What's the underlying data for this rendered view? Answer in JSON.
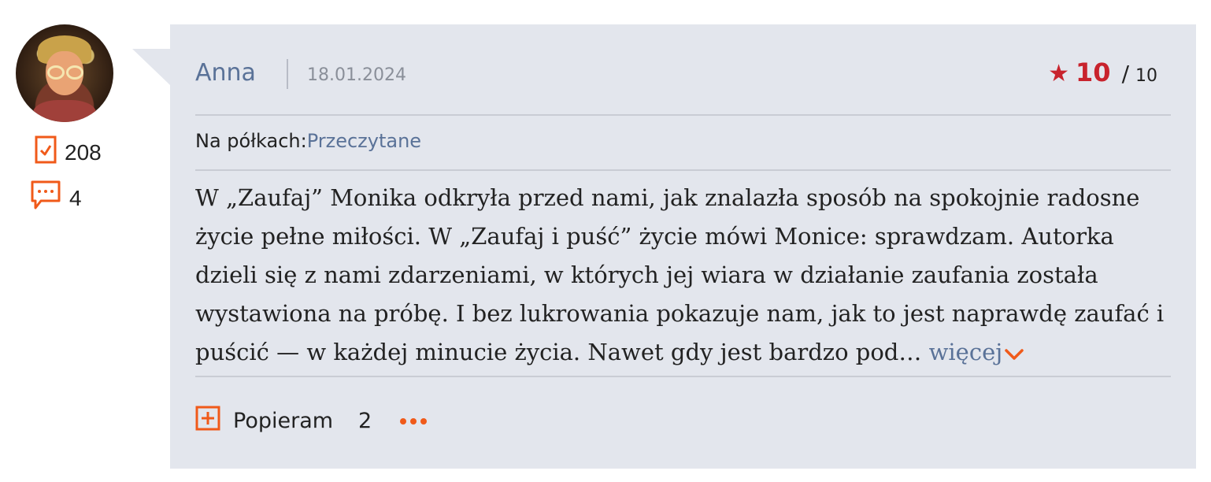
{
  "user": {
    "avatar_icon": "user-avatar",
    "books_count": "208",
    "comments_count": "4"
  },
  "review": {
    "author": "Anna",
    "date": "18.01.2024",
    "rating": {
      "value": "10",
      "separator": "/",
      "max": "10",
      "color": "#c8232d"
    },
    "shelves_label": "Na półkach:",
    "shelf_name": "Przeczytane",
    "text": "W „Zaufaj” Monika odkryła przed nami, jak znalazła sposób na spokojnie radosne życie pełne miłości. W „Zaufaj i puść” życie mówi Monice: sprawdzam. Autorka dzieli się z nami zdarzeniami, w których jej wiara w działanie zaufania została wystawiona na próbę. I bez lukrowania pokazuje nam, jak to jest naprawdę zaufać i puścić — w każdej minucie życia. Nawet gdy jest bardzo pod…",
    "more_label": "więcej",
    "support_label": "Popieram",
    "support_count": "2"
  },
  "colors": {
    "accent": "#f05a1a",
    "link": "#5a7298",
    "card_bg": "#e3e6ed"
  }
}
